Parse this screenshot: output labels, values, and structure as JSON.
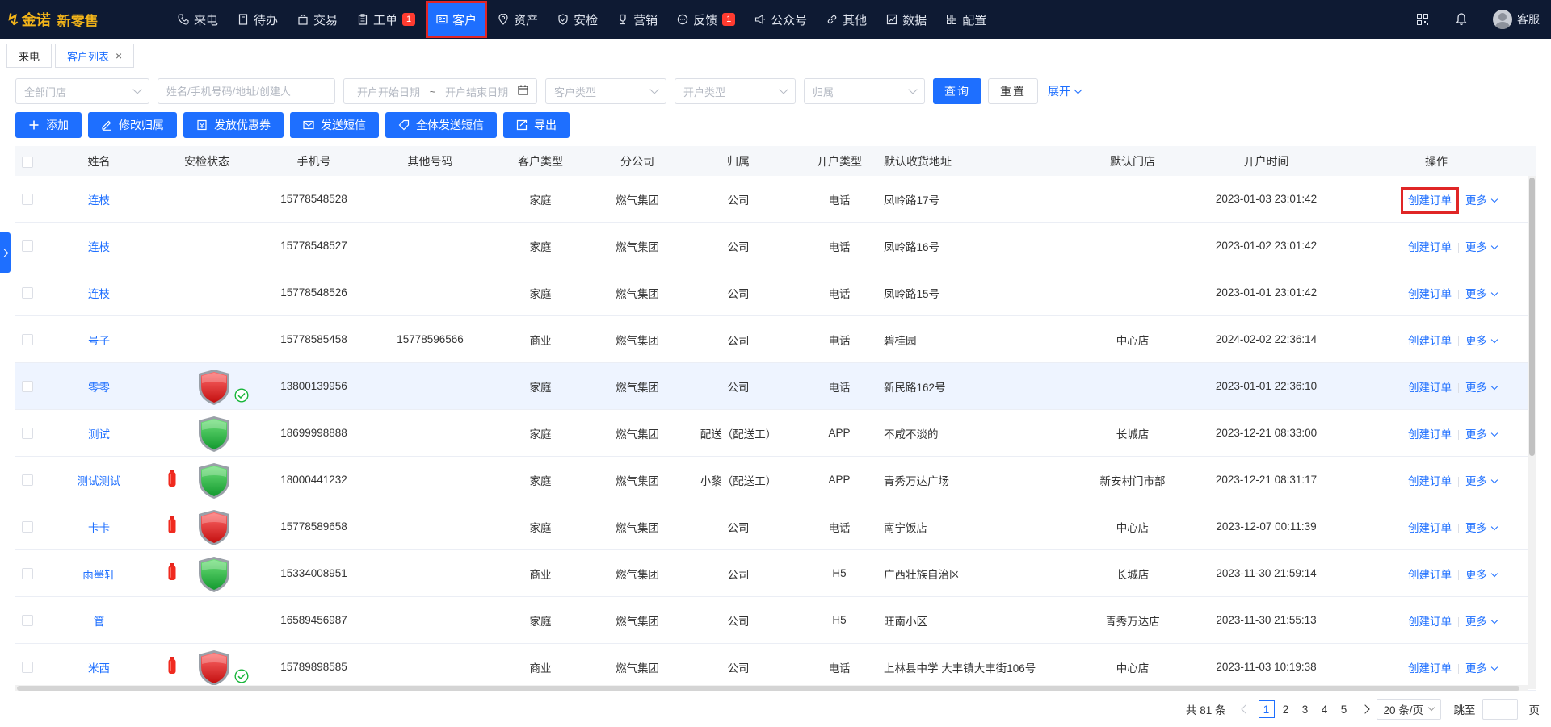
{
  "app": {
    "logo_mark": "↯",
    "brand": "金诺",
    "product": "新零售"
  },
  "nav": {
    "items": [
      {
        "label": "来电",
        "icon": "phone-icon"
      },
      {
        "label": "待办",
        "icon": "document-icon"
      },
      {
        "label": "交易",
        "icon": "bag-icon"
      },
      {
        "label": "工单",
        "icon": "clipboard-icon",
        "badge": "1"
      },
      {
        "label": "客户",
        "icon": "id-card-icon",
        "active": true
      },
      {
        "label": "资产",
        "icon": "location-pin-icon"
      },
      {
        "label": "安检",
        "icon": "shield-icon"
      },
      {
        "label": "营销",
        "icon": "trophy-icon"
      },
      {
        "label": "反馈",
        "icon": "chat-icon",
        "badge": "1"
      },
      {
        "label": "公众号",
        "icon": "megaphone-icon"
      },
      {
        "label": "其他",
        "icon": "link-icon"
      },
      {
        "label": "数据",
        "icon": "chart-icon"
      },
      {
        "label": "配置",
        "icon": "grid-icon"
      }
    ],
    "user": "客服"
  },
  "tabs": [
    {
      "label": "来电",
      "active": false
    },
    {
      "label": "客户列表",
      "active": true,
      "close": "×"
    }
  ],
  "filters": {
    "store": "全部门店",
    "search_placeholder": "姓名/手机号码/地址/创建人",
    "date_start": "开户开始日期",
    "date_sep": "~",
    "date_end": "开户结束日期",
    "customer_type": "客户类型",
    "open_type": "开户类型",
    "belong": "归属",
    "query": "查询",
    "reset": "重置",
    "expand": "展开"
  },
  "actions": [
    {
      "label": "添加",
      "icon": "plus-icon"
    },
    {
      "label": "修改归属",
      "icon": "edit-icon"
    },
    {
      "label": "发放优惠券",
      "icon": "coupon-icon"
    },
    {
      "label": "发送短信",
      "icon": "mail-icon"
    },
    {
      "label": "全体发送短信",
      "icon": "tag-icon"
    },
    {
      "label": "导出",
      "icon": "export-icon"
    }
  ],
  "table": {
    "headers": [
      "姓名",
      "安检状态",
      "手机号",
      "其他号码",
      "客户类型",
      "分公司",
      "归属",
      "开户类型",
      "默认收货地址",
      "默认门店",
      "开户时间",
      "操作"
    ],
    "op_create": "创建订单",
    "op_more": "更多",
    "rows": [
      {
        "name": "连枝",
        "cylinder": false,
        "shield": "",
        "check": false,
        "phone": "15778548528",
        "other": "",
        "ctype": "家庭",
        "branch": "燃气集团",
        "belong": "公司",
        "otype": "电话",
        "address": "凤岭路17号",
        "store": "",
        "time": "2023-01-03 23:01:42"
      },
      {
        "name": "连枝",
        "cylinder": false,
        "shield": "",
        "check": false,
        "phone": "15778548527",
        "other": "",
        "ctype": "家庭",
        "branch": "燃气集团",
        "belong": "公司",
        "otype": "电话",
        "address": "凤岭路16号",
        "store": "",
        "time": "2023-01-02 23:01:42"
      },
      {
        "name": "连枝",
        "cylinder": false,
        "shield": "",
        "check": false,
        "phone": "15778548526",
        "other": "",
        "ctype": "家庭",
        "branch": "燃气集团",
        "belong": "公司",
        "otype": "电话",
        "address": "凤岭路15号",
        "store": "",
        "time": "2023-01-01 23:01:42"
      },
      {
        "name": "号子",
        "cylinder": false,
        "shield": "",
        "check": false,
        "phone": "15778585458",
        "other": "15778596566",
        "ctype": "商业",
        "branch": "燃气集团",
        "belong": "公司",
        "otype": "电话",
        "address": "碧桂园",
        "store": "中心店",
        "time": "2024-02-02 22:36:14"
      },
      {
        "name": "零零",
        "cylinder": false,
        "shield": "red",
        "check": true,
        "phone": "13800139956",
        "other": "",
        "ctype": "家庭",
        "branch": "燃气集团",
        "belong": "公司",
        "otype": "电话",
        "address": "新民路162号",
        "store": "",
        "time": "2023-01-01 22:36:10",
        "highlight": true
      },
      {
        "name": "测试",
        "cylinder": false,
        "shield": "green",
        "check": false,
        "phone": "18699998888",
        "other": "",
        "ctype": "家庭",
        "branch": "燃气集团",
        "belong": "配送（配送工）",
        "otype": "APP",
        "address": "不咸不淡的",
        "store": "长城店",
        "time": "2023-12-21 08:33:00"
      },
      {
        "name": "测试测试",
        "cylinder": true,
        "shield": "green",
        "check": false,
        "phone": "18000441232",
        "other": "",
        "ctype": "家庭",
        "branch": "燃气集团",
        "belong": "小黎（配送工）",
        "otype": "APP",
        "address": "青秀万达广场",
        "store": "新安村门市部",
        "time": "2023-12-21 08:31:17"
      },
      {
        "name": "卡卡",
        "cylinder": true,
        "shield": "red",
        "check": false,
        "phone": "15778589658",
        "other": "",
        "ctype": "家庭",
        "branch": "燃气集团",
        "belong": "公司",
        "otype": "电话",
        "address": "南宁饭店",
        "store": "中心店",
        "time": "2023-12-07 00:11:39"
      },
      {
        "name": "雨墨轩",
        "cylinder": true,
        "shield": "green",
        "check": false,
        "phone": "15334008951",
        "other": "",
        "ctype": "商业",
        "branch": "燃气集团",
        "belong": "公司",
        "otype": "H5",
        "address": "广西壮族自治区",
        "store": "长城店",
        "time": "2023-11-30 21:59:14"
      },
      {
        "name": "管",
        "cylinder": false,
        "shield": "",
        "check": false,
        "phone": "16589456987",
        "other": "",
        "ctype": "家庭",
        "branch": "燃气集团",
        "belong": "公司",
        "otype": "H5",
        "address": "旺南小区",
        "store": "青秀万达店",
        "time": "2023-11-30 21:55:13"
      },
      {
        "name": "米西",
        "cylinder": true,
        "shield": "red",
        "check": true,
        "phone": "15789898585",
        "other": "",
        "ctype": "商业",
        "branch": "燃气集团",
        "belong": "公司",
        "otype": "电话",
        "address": "上林县中学 大丰镇大丰街106号",
        "store": "中心店",
        "time": "2023-11-03 10:19:38"
      }
    ]
  },
  "pagination": {
    "total": "共 81 条",
    "pages": [
      "1",
      "2",
      "3",
      "4",
      "5"
    ],
    "current": "1",
    "page_size": "20 条/页",
    "jump_label": "跳至",
    "page_unit": "页"
  },
  "colors": {
    "nav_bg": "#0e1a33",
    "accent": "#1e6fff",
    "highlight_box": "#e02626",
    "shield_red": "#d61f1f",
    "shield_green": "#1fa83a"
  }
}
